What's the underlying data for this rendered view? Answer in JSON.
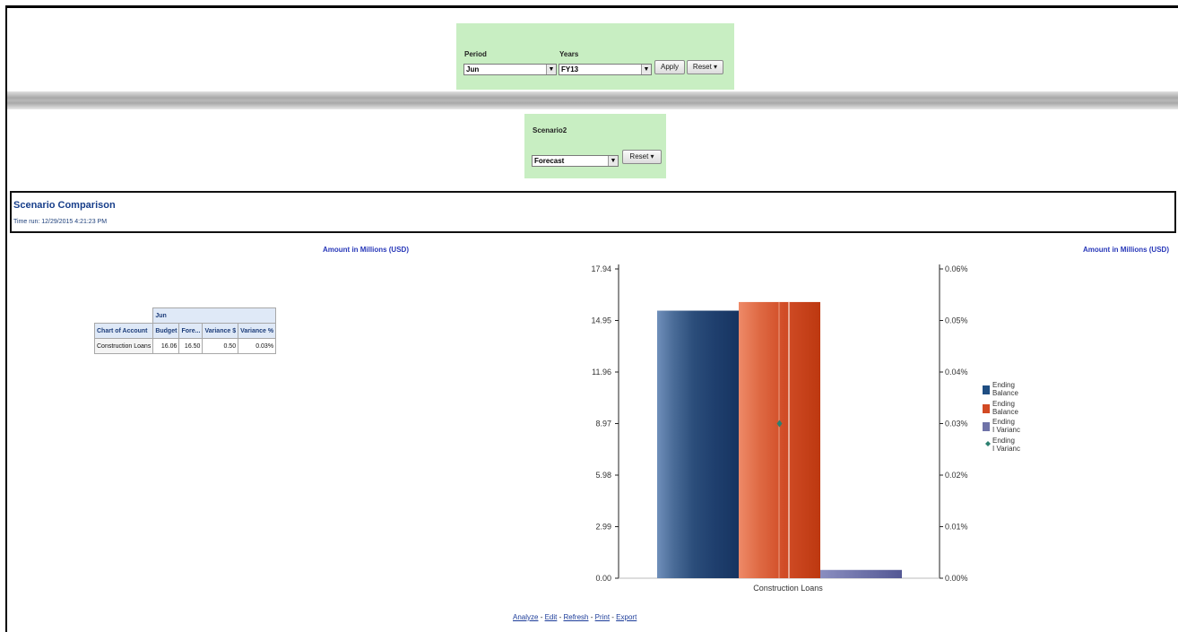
{
  "prompts_top": {
    "period_label": "Period",
    "period_value": "Jun",
    "years_label": "Years",
    "years_value": "FY13",
    "apply_label": "Apply",
    "reset_label": "Reset ▾"
  },
  "prompts_scenario": {
    "scenario_label": "Scenario2",
    "scenario_value": "Forecast",
    "reset_label": "Reset ▾"
  },
  "report": {
    "title": "Scenario Comparison",
    "time_run": "Time run: 12/29/2015 4:21:23 PM",
    "amount_label_left": "Amount in Millions (USD)",
    "amount_label_right": "Amount in Millions (USD)"
  },
  "table": {
    "period_header": "Jun",
    "row_header": "Chart of Account",
    "columns": [
      "Budget",
      "Fore...",
      "Variance $",
      "Variance %"
    ],
    "rows": [
      {
        "account": "Construction Loans",
        "values": [
          "16.06",
          "16.50",
          "0.50",
          "0.03%"
        ]
      }
    ]
  },
  "chart_data": {
    "type": "bar",
    "categories": [
      "Construction Loans"
    ],
    "series": [
      {
        "name": "Ending Balance",
        "values": [
          15.52
        ],
        "color": "#1f4e82",
        "axis": "left"
      },
      {
        "name": "Ending Balance",
        "values": [
          16.02
        ],
        "color": "#d24a24",
        "axis": "left"
      },
      {
        "name": "Ending I Variance",
        "values": [
          0.48
        ],
        "color": "#6f73a8",
        "axis": "left"
      },
      {
        "name": "Ending I Variance",
        "values": [
          0.03
        ],
        "color": "#2c8070",
        "axis": "right",
        "marker": true
      }
    ],
    "y_ticks": [
      "17.94",
      "14.95",
      "11.96",
      "8.97",
      "5.98",
      "2.99",
      "0.00"
    ],
    "y2_ticks": [
      "0.06%",
      "0.05%",
      "0.04%",
      "0.03%",
      "0.02%",
      "0.01%",
      "0.00%"
    ],
    "ylim": [
      0,
      17.94
    ],
    "y2lim": [
      0,
      0.06
    ],
    "legend_position": "right"
  },
  "links": {
    "analyze": "Analyze",
    "edit": "Edit",
    "refresh": "Refresh",
    "print": "Print",
    "export": "Export",
    "separator": " - "
  }
}
